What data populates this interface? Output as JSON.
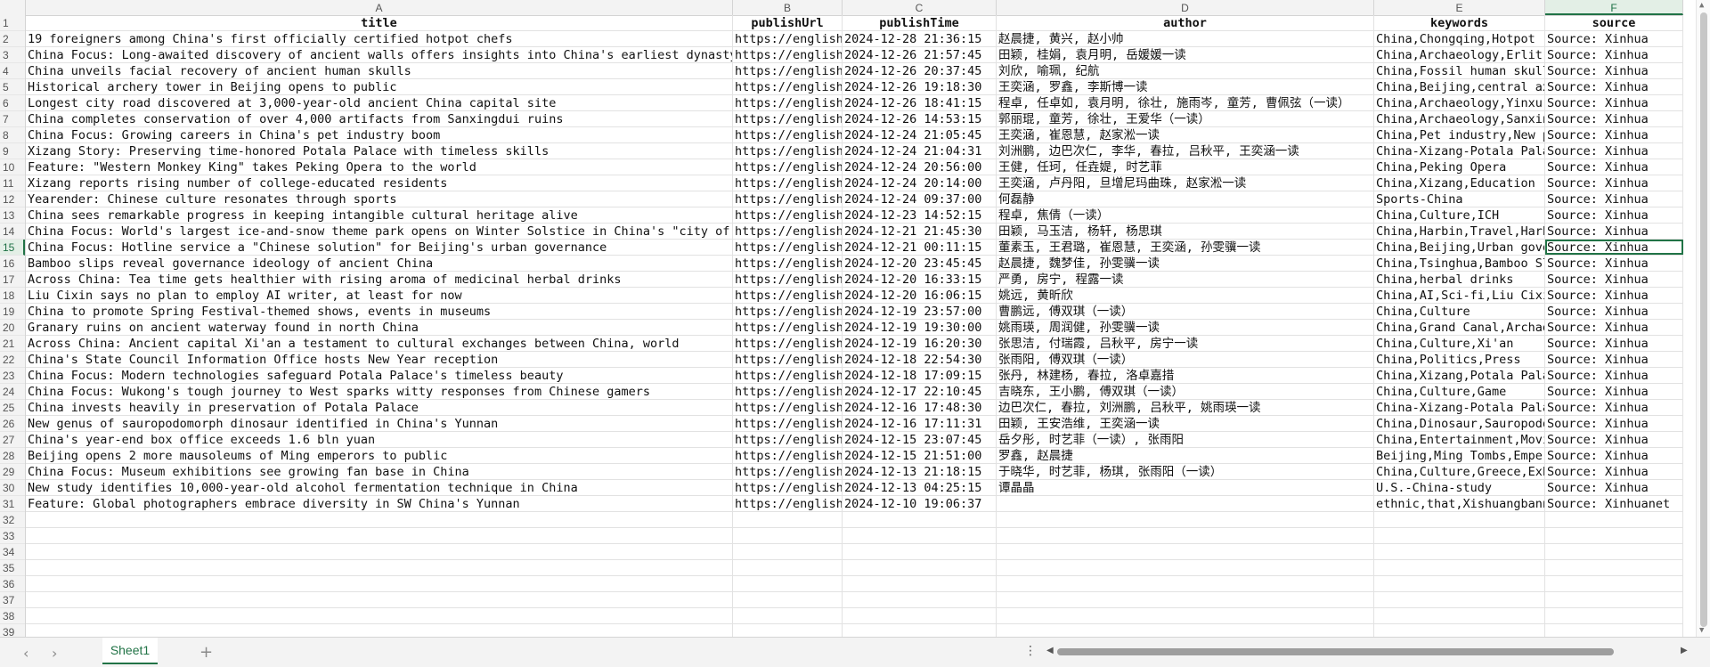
{
  "columns": [
    "A",
    "B",
    "C",
    "D",
    "E",
    "F"
  ],
  "selected_column": "F",
  "selected_row": 15,
  "headers": [
    "title",
    "publishUrl",
    "publishTime",
    "author",
    "keywords",
    "source"
  ],
  "rows": [
    [
      "19 foreigners among China's first officially certified hotpot chefs",
      "https://english",
      "2024-12-28 21:36:15",
      "赵晨捷, 黄兴, 赵小帅",
      "China,Chongqing,Hotpot (",
      "Source: Xinhua"
    ],
    [
      "China Focus: Long-awaited discovery of ancient walls offers insights into China's earliest dynasty",
      "https://english",
      "2024-12-26 21:57:45",
      "田颖, 桂娟, 袁月明, 岳媛媛一读",
      "China,Archaeology,Erlit(",
      "Source: Xinhua"
    ],
    [
      "China unveils facial recovery of ancient human skulls",
      "https://english",
      "2024-12-26 20:37:45",
      "刘欣, 喻珮, 纪航",
      "China,Fossil human skull",
      "Source: Xinhua"
    ],
    [
      "Historical archery tower in Beijing opens to public",
      "https://english",
      "2024-12-26 19:18:30",
      "王奕涵, 罗鑫, 李斯博一读",
      "China,Beijing,central ax",
      "Source: Xinhua"
    ],
    [
      "Longest city road discovered at 3,000-year-old ancient China capital site",
      "https://english",
      "2024-12-26 18:41:15",
      "程卓, 任卓如, 袁月明, 徐壮, 施雨岑, 童芳, 曹佩弦（一读）",
      "China,Archaeology,Yinxu",
      "Source: Xinhua"
    ],
    [
      "China completes conservation of over 4,000 artifacts from Sanxingdui ruins",
      "https://english",
      "2024-12-26 14:53:15",
      "郭丽琨, 童芳, 徐壮, 王爱华（一读）",
      "China,Archaeology,Sanxin",
      "Source: Xinhua"
    ],
    [
      "China Focus: Growing careers in China's pet industry boom",
      "https://english",
      "2024-12-24 21:05:45",
      "王奕涵, 崔恩慧, 赵家淞一读",
      "China,Pet industry,New p",
      "Source: Xinhua"
    ],
    [
      "Xizang Story: Preserving time-honored Potala Palace with timeless skills",
      "https://english",
      "2024-12-24 21:04:31",
      "刘洲鹏, 边巴次仁, 李华, 春拉, 吕秋平, 王奕涵一读",
      "China-Xizang-Potala Pala",
      "Source: Xinhua"
    ],
    [
      "Feature: \"Western Monkey King\" takes Peking Opera to the world",
      "https://english",
      "2024-12-24 20:56:00",
      "王健, 任珂, 任垚媞, 时艺菲",
      "China,Peking Opera",
      "Source: Xinhua"
    ],
    [
      "Xizang reports rising number of college-educated residents",
      "https://english",
      "2024-12-24 20:14:00",
      "王奕涵, 卢丹阳, 旦增尼玛曲珠, 赵家淞一读",
      "China,Xizang,Education",
      "Source: Xinhua"
    ],
    [
      "Yearender: Chinese culture resonates through sports",
      "https://english",
      "2024-12-24 09:37:00",
      "何磊静",
      "Sports-China",
      "Source: Xinhua"
    ],
    [
      "China sees remarkable progress in keeping intangible cultural heritage alive",
      "https://english",
      "2024-12-23 14:52:15",
      "程卓, 焦倩（一读）",
      "China,Culture,ICH",
      "Source: Xinhua"
    ],
    [
      "China Focus: World's largest ice-and-snow theme park opens on Winter Solstice in China's \"city of ice\"",
      "https://english",
      "2024-12-21 21:45:30",
      "田颖, 马玉洁, 杨轩, 杨思琪",
      "China,Harbin,Travel,Harb",
      "Source: Xinhua"
    ],
    [
      "China Focus: Hotline service a \"Chinese solution\" for Beijing's urban governance",
      "https://english",
      "2024-12-21 00:11:15",
      "董素玉, 王君璐, 崔恩慧, 王奕涵, 孙雯骥一读",
      "China,Beijing,Urban gove",
      "Source: Xinhua"
    ],
    [
      "Bamboo slips reveal governance ideology of ancient China",
      "https://english",
      "2024-12-20 23:45:45",
      "赵晨捷, 魏梦佳, 孙雯骥一读",
      "China,Tsinghua,Bamboo Sl",
      "Source: Xinhua"
    ],
    [
      "Across China: Tea time gets healthier with rising aroma of medicinal herbal drinks",
      "https://english",
      "2024-12-20 16:33:15",
      "严勇, 房宁, 程露一读",
      "China,herbal drinks",
      "Source: Xinhua"
    ],
    [
      "Liu Cixin says no plan to employ AI writer, at least for now",
      "https://english",
      "2024-12-20 16:06:15",
      "姚远, 黄昕欣",
      "China,AI,Sci-fi,Liu Cixi",
      "Source: Xinhua"
    ],
    [
      "China to promote Spring Festival-themed shows, events in museums",
      "https://english",
      "2024-12-19 23:57:00",
      "曹鹏远, 傅双琪（一读）",
      "China,Culture",
      "Source: Xinhua"
    ],
    [
      "Granary ruins on ancient waterway found in north China",
      "https://english",
      "2024-12-19 19:30:00",
      "姚雨瑛, 周润健, 孙雯骥一读",
      "China,Grand Canal,Archae",
      "Source: Xinhua"
    ],
    [
      "Across China: Ancient capital Xi'an a testament to cultural exchanges between China, world",
      "https://english",
      "2024-12-19 16:20:30",
      "张思洁, 付瑞霞, 吕秋平, 房宁一读",
      "China,Culture,Xi'an",
      "Source: Xinhua"
    ],
    [
      "China's State Council Information Office hosts New Year reception",
      "https://english",
      "2024-12-18 22:54:30",
      "张雨阳, 傅双琪（一读）",
      "China,Politics,Press",
      "Source: Xinhua"
    ],
    [
      "China Focus: Modern technologies safeguard Potala Palace's timeless beauty",
      "https://english",
      "2024-12-18 17:09:15",
      "张丹, 林建杨, 春拉, 洛卓嘉措",
      "China,Xizang,Potala Pala",
      "Source: Xinhua"
    ],
    [
      "China Focus: Wukong's tough journey to West sparks witty responses from Chinese gamers",
      "https://english",
      "2024-12-17 22:10:45",
      "吉晓东, 王小鹏, 傅双琪（一读）",
      "China,Culture,Game",
      "Source: Xinhua"
    ],
    [
      "China invests heavily in preservation of Potala Palace",
      "https://english",
      "2024-12-16 17:48:30",
      "边巴次仁, 春拉, 刘洲鹏, 吕秋平, 姚雨瑛一读",
      "China-Xizang-Potala Pala",
      "Source: Xinhua"
    ],
    [
      "New genus of sauropodomorph dinosaur identified in China's Yunnan",
      "https://english",
      "2024-12-16 17:11:31",
      "田颖, 王安浩维, 王奕涵一读",
      "China,Dinosaur,Sauropodo",
      "Source: Xinhua"
    ],
    [
      "China's year-end box office exceeds 1.6 bln yuan",
      "https://english",
      "2024-12-15 23:07:45",
      "岳夕彤, 时艺菲（一读）, 张雨阳",
      "China,Entertainment,Movi",
      "Source: Xinhua"
    ],
    [
      "Beijing opens 2 more mausoleums of Ming emperors to public",
      "https://english",
      "2024-12-15 21:51:00",
      "罗鑫, 赵晨捷",
      "Beijing,Ming Tombs,Emper",
      "Source: Xinhua"
    ],
    [
      "China Focus: Museum exhibitions see growing fan base in China",
      "https://english",
      "2024-12-13 21:18:15",
      "于晓华, 时艺菲, 杨琪, 张雨阳（一读）",
      "China,Culture,Greece,Exh",
      "Source: Xinhua"
    ],
    [
      "New study identifies 10,000-year-old alcohol fermentation technique in China",
      "https://english",
      "2024-12-13 04:25:15",
      "谭晶晶",
      "U.S.-China-study",
      "Source: Xinhua"
    ],
    [
      "Feature: Global photographers embrace diversity in SW China's Yunnan",
      "https://english",
      "2024-12-10 19:06:37",
      "",
      "ethnic,that,Xishuangbann",
      "Source: Xinhuanet"
    ]
  ],
  "empty_rows": [
    32,
    33,
    34,
    35,
    36,
    37,
    38,
    39
  ],
  "sheet_tab": "Sheet1",
  "add_sheet_label": "+",
  "nav_prev": "‹",
  "nav_next": "›",
  "more_label": "⋮",
  "accent_color": "#217346"
}
